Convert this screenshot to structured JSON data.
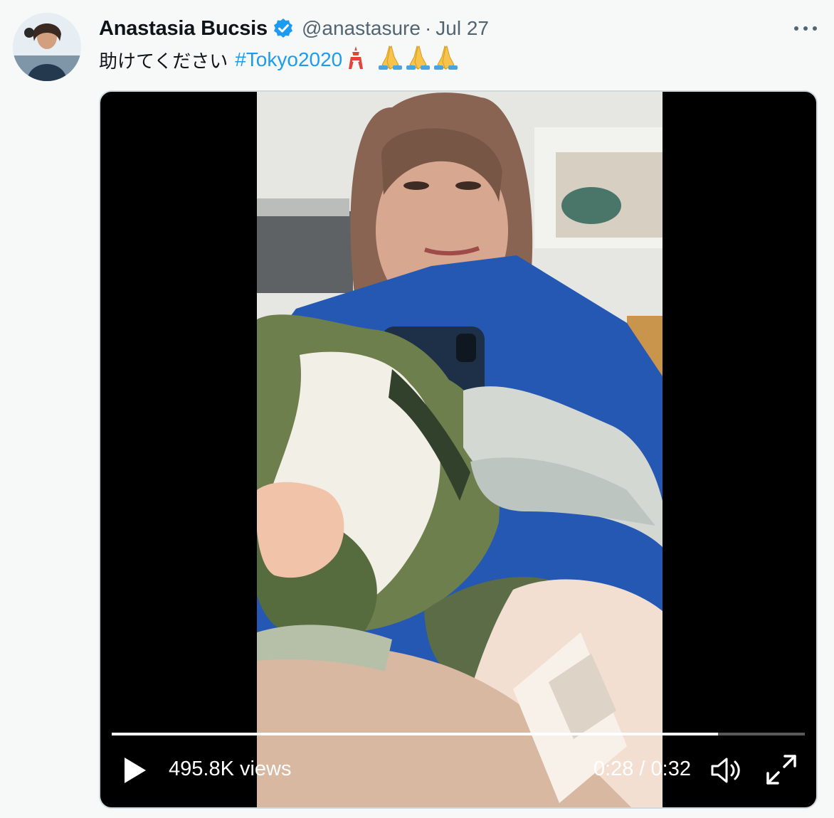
{
  "tweet": {
    "author_name": "Anastasia Bucsis",
    "handle": "@anastasure",
    "separator": "·",
    "date": "Jul 27",
    "text": "助けてください",
    "hashtag": "#Tokyo2020",
    "icons": {
      "verified": "verified-badge-icon",
      "more": "more-options-icon",
      "tower": "tokyo-tower-emoji",
      "pray": "folded-hands-emoji"
    }
  },
  "video": {
    "views": "495.8K views",
    "time": "0:28 / 0:32",
    "progress_fraction": 0.875,
    "icons": {
      "play": "play-icon",
      "volume": "volume-icon",
      "fullscreen": "fullscreen-icon"
    }
  },
  "colors": {
    "accent": "#1d9bf0",
    "text": "#0f1419",
    "secondary_text": "#536471",
    "background": "#f7f9f9"
  }
}
